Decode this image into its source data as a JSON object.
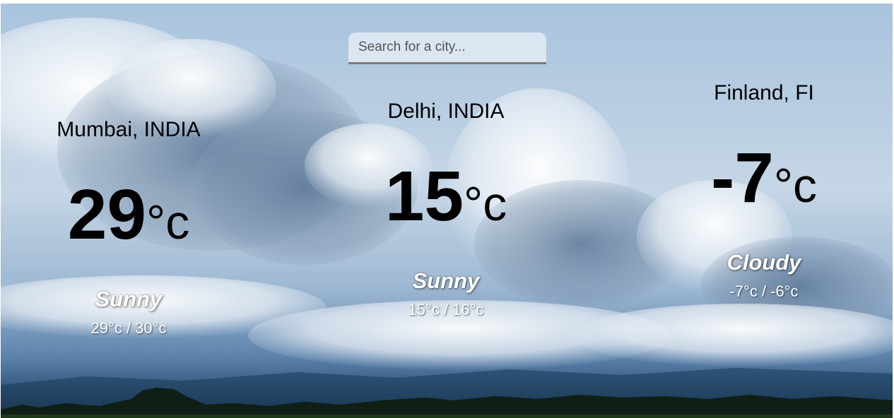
{
  "search": {
    "placeholder": "Search for a city..."
  },
  "cities": [
    {
      "name": "Mumbai, INDIA",
      "temp": "29",
      "unit": "°c",
      "condition": "Sunny",
      "hilow": "29°c / 30°c"
    },
    {
      "name": "Delhi, INDIA",
      "temp": "15",
      "unit": "°c",
      "condition": "Sunny",
      "hilow": "15°c / 16°c"
    },
    {
      "name": "Finland, FI",
      "temp": "-7",
      "unit": "°c",
      "condition": "Cloudy",
      "hilow": "-7°c / -6°c"
    }
  ],
  "colors": {
    "sky": "#a9c4de",
    "text_primary": "#000000",
    "text_secondary": "#ffffff",
    "search_border": "#7b7b7b"
  }
}
